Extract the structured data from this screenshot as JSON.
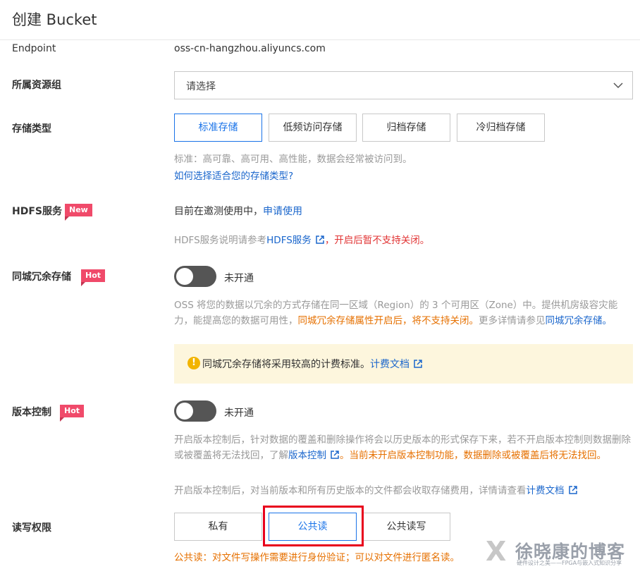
{
  "header": {
    "title": "创建 Bucket"
  },
  "endpoint": {
    "label": "Endpoint",
    "value": "oss-cn-hangzhou.aliyuncs.com"
  },
  "resource_group": {
    "label": "所属资源组",
    "placeholder": "请选择"
  },
  "storage_class": {
    "label": "存储类型",
    "options": [
      "标准存储",
      "低频访问存储",
      "归档存储",
      "冷归档存储"
    ],
    "selected": "标准存储",
    "description": "标准：高可靠、高可用、高性能，数据会经常被访问到。",
    "help_link": "如何选择适合您的存储类型?"
  },
  "hdfs": {
    "label": "HDFS服务",
    "badge": "New",
    "status_text": "目前在邀测使用中，",
    "apply_link": "申请使用",
    "note_prefix": "HDFS服务说明请参考",
    "note_link": "HDFS服务",
    "note_warning": "，开启后暂不支持关闭。"
  },
  "zone_redundancy": {
    "label": "同城冗余存储",
    "badge": "Hot",
    "toggle_state": "未开通",
    "desc_part1": "OSS 将您的数据以冗余的方式存储在同一区域（Region）的 3 个可用区（Zone）中。提供机房级容灾能力，能提高您的数据可用性，",
    "desc_warning": "同城冗余存储属性开启后，将不支持关闭。",
    "desc_part2": "更多详情请参见",
    "desc_link": "同城冗余存储。",
    "notice_text": "同城冗余存储将采用较高的计费标准。",
    "notice_link": "计费文档"
  },
  "versioning": {
    "label": "版本控制",
    "badge": "Hot",
    "toggle_state": "未开通",
    "desc_part1": "开启版本控制后，针对数据的覆盖和删除操作将会以历史版本的形式保存下来，若不开启版本控制则数据删除或被覆盖将无法找回，了解",
    "desc_link": "版本控制",
    "desc_warning": "。当前未开启版本控制功能，数据删除或被覆盖后将无法找回。",
    "billing_text": "开启版本控制后，对当前版本和所有历史版本的文件都会收取存储费用，详情请查看",
    "billing_link": "计费文档"
  },
  "acl": {
    "label": "读写权限",
    "options": [
      "私有",
      "公共读",
      "公共读写"
    ],
    "selected": "公共读",
    "warning": "公共读：对文件写操作需要进行身份验证；可以对文件进行匿名读。"
  },
  "watermark": {
    "name": "徐晓康的博客",
    "subtitle": "硬件设计之美——FPGA与嵌入式知识分享"
  },
  "colors": {
    "accent": "#1a73e8",
    "link": "#1a66cc",
    "badge": "#f04a6a",
    "warning_orange": "#e67000",
    "warning_red": "#e13333",
    "highlight_box": "#e8001c"
  }
}
